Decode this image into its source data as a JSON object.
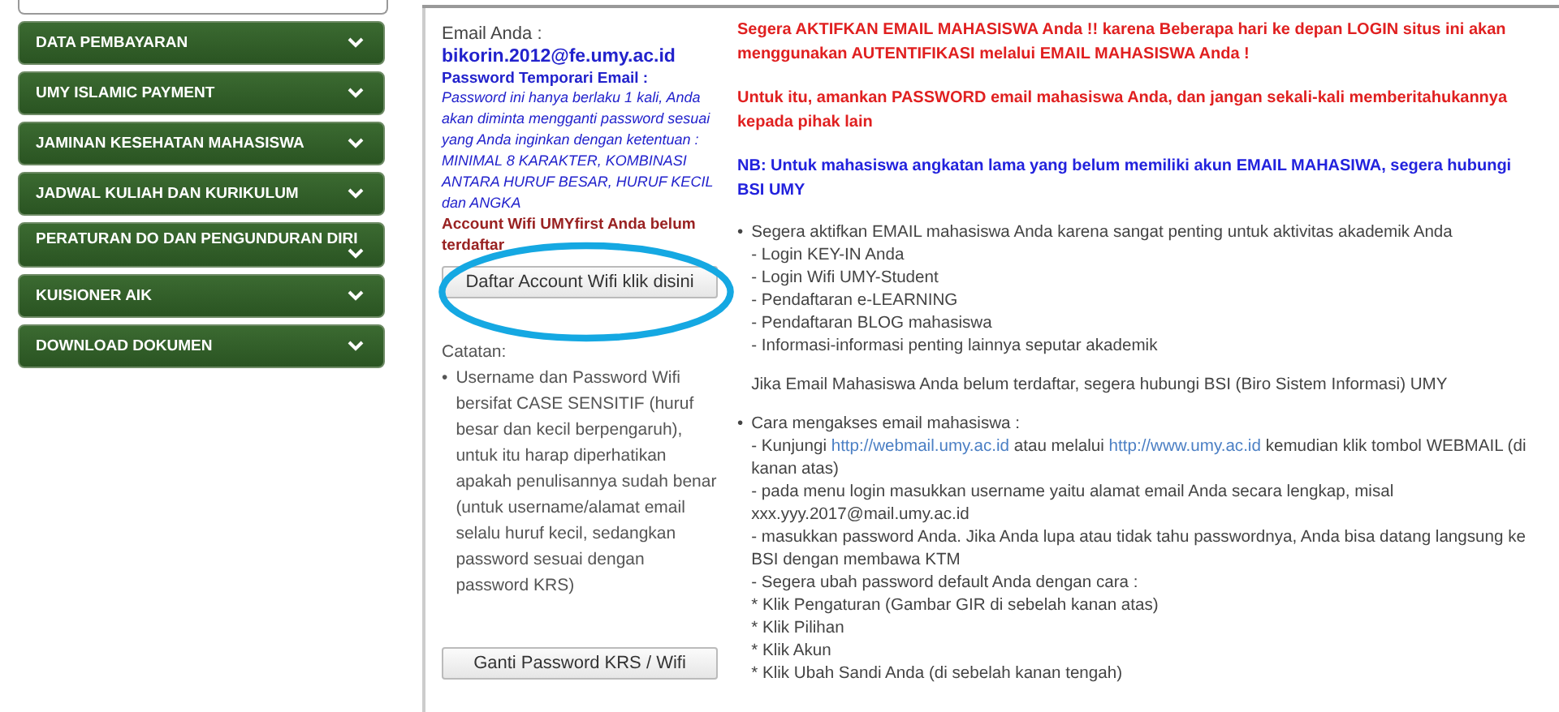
{
  "sidebar": {
    "items": [
      {
        "label": "DATA PEMBAYARAN"
      },
      {
        "label": "UMY ISLAMIC PAYMENT"
      },
      {
        "label": "JAMINAN KESEHATAN MAHASISWA"
      },
      {
        "label": "JADWAL KULIAH DAN KURIKULUM"
      },
      {
        "label": "PERATURAN DO DAN PENGUNDURAN DIRI"
      },
      {
        "label": "KUISIONER AIK"
      },
      {
        "label": "DOWNLOAD DOKUMEN"
      }
    ]
  },
  "account": {
    "email_label": "Email Anda :",
    "email": "bikorin.2012@fe.umy.ac.id",
    "password_label": "Password Temporari Email :",
    "password_note": "Password ini hanya berlaku 1 kali, Anda akan diminta mengganti password sesuai yang Anda inginkan dengan ketentuan : MINIMAL 8 KARAKTER, KOMBINASI ANTARA HURUF BESAR, HURUF KECIL dan ANGKA",
    "wifi_status": "Account Wifi UMYfirst Anda belum terdaftar",
    "register_button": "Daftar Account Wifi klik disini",
    "notes_label": "Catatan:",
    "notes": [
      {
        "marker": "•",
        "text": "Username dan Password Wifi bersifat CASE SENSITIF (huruf besar dan kecil berpengaruh), untuk itu harap diperhatikan apakah penulisannya sudah benar (untuk username/alamat email selalu huruf kecil, sedangkan password sesuai dengan password KRS)"
      }
    ],
    "change_button": "Ganti Password KRS / Wifi"
  },
  "notices": [
    {
      "kind": "warning",
      "text": "Segera AKTIFKAN EMAIL MAHASISWA Anda !! karena Beberapa hari ke depan LOGIN situs ini akan menggunakan AUTENTIFIKASI melalui EMAIL MAHASISWA Anda !"
    },
    {
      "kind": "warning",
      "text": "Untuk itu, amankan PASSWORD email mahasiswa Anda, dan jangan sekali-kali memberitahukannya kepada pihak lain"
    },
    {
      "kind": "info",
      "text": "NB: Untuk mahasiswa angkatan lama yang belum memiliki akun EMAIL MAHASIWA, segera hubungi BSI UMY"
    }
  ],
  "bullets": [
    {
      "marker": "•",
      "title": "Segera aktifkan EMAIL mahasiswa Anda karena sangat penting untuk aktivitas akademik Anda",
      "lines": [
        "- Login KEY-IN Anda",
        "- Login Wifi UMY-Student",
        "- Pendaftaran e-LEARNING",
        "- Pendaftaran BLOG mahasiswa",
        "- Informasi-informasi penting lainnya seputar akademik"
      ],
      "footer": "Jika Email Mahasiswa Anda belum terdaftar, segera hubungi BSI (Biro Sistem Informasi) UMY"
    },
    {
      "marker": "•",
      "title": "Cara mengakses email mahasiswa :",
      "visit": {
        "before": "- Kunjungi",
        "link1": "http://webmail.umy.ac.id",
        "middle": "atau melalui",
        "link2": "http://www.umy.ac.id",
        "after": "kemudian klik tombol WEBMAIL (di kanan atas)"
      },
      "lines": [
        "- pada menu login masukkan username yaitu alamat email Anda secara lengkap, misal xxx.yyy.2017@mail.umy.ac.id",
        "- masukkan password Anda. Jika Anda lupa atau tidak tahu passwordnya, Anda bisa datang langsung ke BSI dengan membawa KTM",
        "- Segera ubah password default Anda dengan cara :",
        "* Klik Pengaturan (Gambar GIR di sebelah kanan atas)",
        "* Klik Pilihan",
        "* Klik Akun",
        "* Klik Ubah Sandi Anda (di sebelah kanan tengah)"
      ]
    }
  ]
}
